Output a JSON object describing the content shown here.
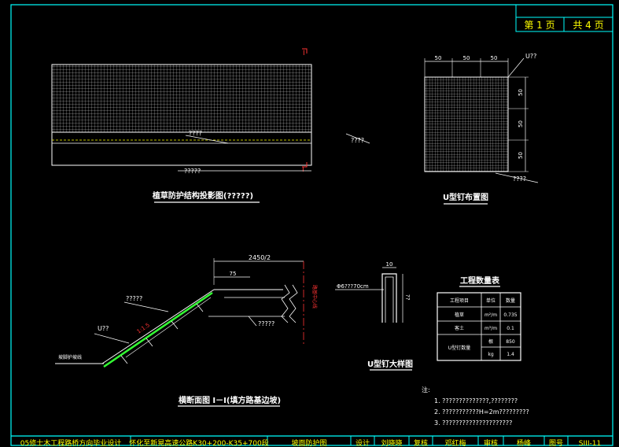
{
  "colors": {
    "background": "#000000",
    "frame": "#00ffff",
    "line": "#ffffff",
    "accent_yellow": "#ffff00",
    "accent_green": "#33ff33",
    "accent_red": "#ff3333"
  },
  "header": {
    "page_current": "第 1 页",
    "page_total": "共 4 页"
  },
  "views": {
    "plan": {
      "title": "植草防护结构投影图(?????)",
      "label_top": "????",
      "label_right": "????",
      "label_bottom": "?????",
      "section_mark_top": "I",
      "section_mark_bottom": "I"
    },
    "u_nail_layout": {
      "title": "U型钉布置图",
      "dim_top": [
        "50",
        "50",
        "50"
      ],
      "dim_right": [
        "50",
        "50",
        "50"
      ],
      "label_u": "U??",
      "label_bottom": "????"
    },
    "section": {
      "title": "横断面图 I－I(填方路基边坡)",
      "dim_top": "2450/2",
      "dim_small": "75",
      "label_grass": "?????",
      "label_u": "U??",
      "label_ratio": "1:1.5",
      "label_road": "?????",
      "label_center": "路基中心线",
      "label_toe": "坡脚护坡线"
    },
    "u_detail": {
      "title": "U型钉大样图",
      "dim_width": "10",
      "label_diameter": "Φ6???70cm",
      "label_length": "??"
    },
    "quantity_table": {
      "title": "工程数量表",
      "headers": [
        "工程项目",
        "单位",
        "数量"
      ],
      "rows": [
        [
          "植草",
          "m²/m",
          "0.735"
        ],
        [
          "客土",
          "m³/m",
          "0.1"
        ],
        [
          "U型钉",
          "根",
          "850"
        ],
        [
          "",
          "kg",
          "1.4"
        ]
      ],
      "row_merge_label_1": "植草",
      "row_merge_label_2": "客土",
      "row_merge_label_3": "U型钉数量"
    },
    "notes": {
      "heading": "注:",
      "items": [
        "1. ??????????????,????????",
        "2. ???????????H=2m?????????",
        "3. ?????????????????????"
      ]
    }
  },
  "title_block": {
    "project": "05修士木工程路桥方向毕业设计",
    "section": "怀化至新晃高速公路K30+200-K35+700段",
    "drawing_name": "坡面防护图",
    "design_label": "设计",
    "design_name": "刘晓晓",
    "review_label": "复核",
    "review_name": "邓红梅",
    "check_label": "审核",
    "check_name": "杨峰",
    "fig_label": "图号",
    "fig_no": "SIII-11"
  }
}
